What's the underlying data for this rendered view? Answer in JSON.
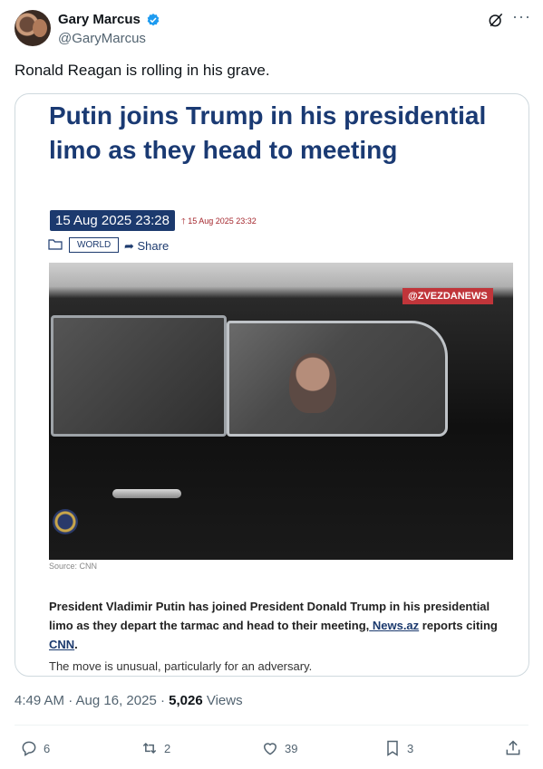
{
  "author": {
    "name": "Gary Marcus",
    "handle": "@GaryMarcus"
  },
  "tweet": {
    "text": "Ronald Reagan is rolling in his grave."
  },
  "card": {
    "headline": "Putin joins Trump in his presidential limo as they head to meeting",
    "date": "15 Aug 2025 23:28",
    "updated": "15 Aug 2025 23:32",
    "tag": "WORLD",
    "share": "Share",
    "watermark": "@ZVEZDANEWS",
    "source": "Source: CNN",
    "body1_before": "President Vladimir Putin has joined President Donald Trump in his presidential limo as they depart the tarmac and head to their meeting,",
    "body1_link1": " News.az",
    "body1_mid": " reports citing ",
    "body1_link2": "CNN",
    "body1_end": ".",
    "body2": "The move is unusual, particularly for an adversary."
  },
  "meta": {
    "time": "4:49 AM · Aug 16, 2025 · ",
    "views_count": "5,026",
    "views_label": " Views"
  },
  "actions": {
    "replies": "6",
    "reposts": "2",
    "likes": "39",
    "bookmarks": "3"
  },
  "colors": {
    "verified": "#1d9bf0",
    "headline": "#1a3a73",
    "muted": "#536471"
  }
}
